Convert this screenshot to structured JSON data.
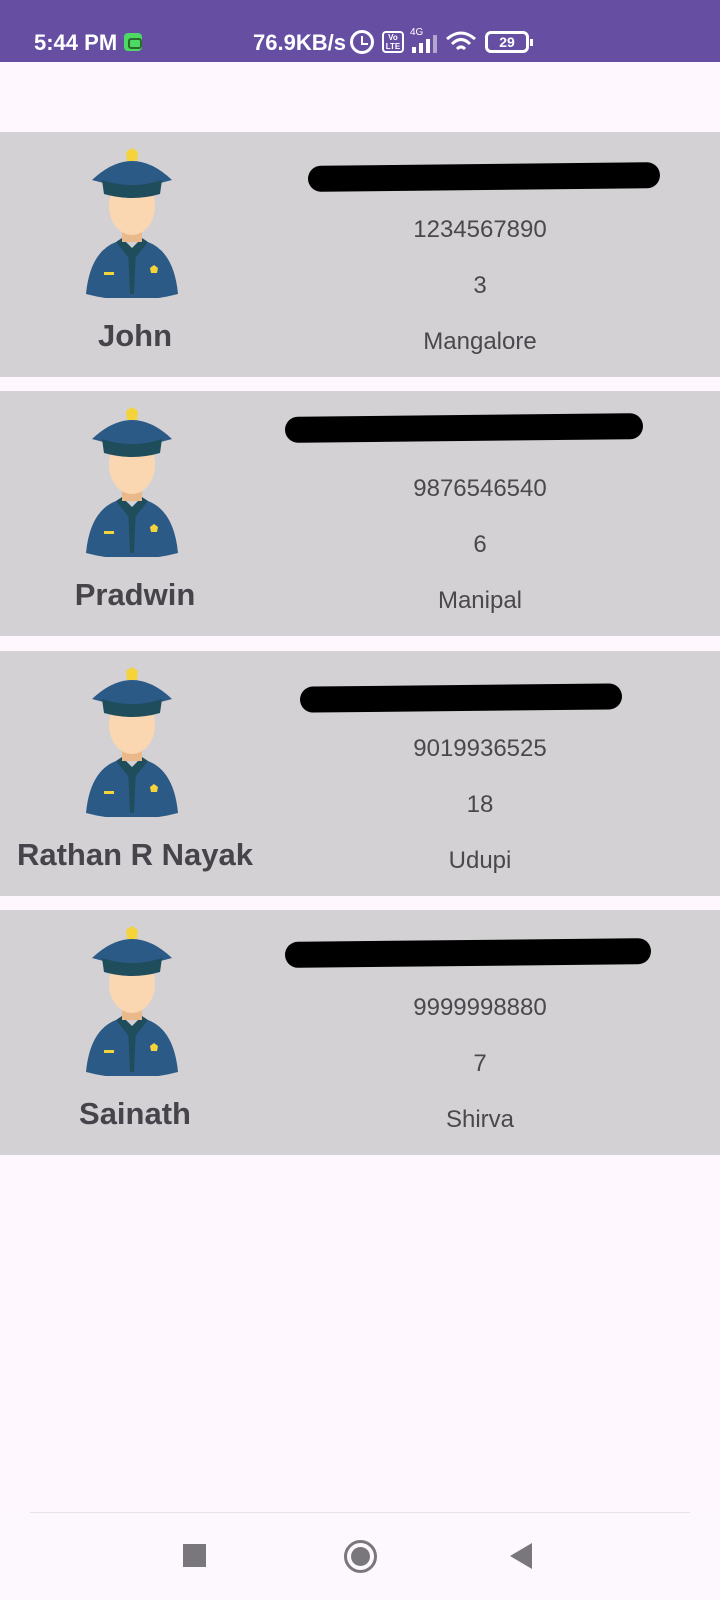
{
  "status_bar": {
    "time": "5:44 PM",
    "speed": "76.9KB/s",
    "network": "4G",
    "battery": "29",
    "volte_label": "Vo LTE",
    "icons": [
      "app-notification-icon",
      "alarm-icon",
      "volte-icon",
      "signal-icon",
      "wifi-icon",
      "battery-icon"
    ]
  },
  "officers": [
    {
      "name": "John",
      "phone": "1234567890",
      "count": "3",
      "city": "Mangalore"
    },
    {
      "name": "Pradwin",
      "phone": "9876546540",
      "count": "6",
      "city": "Manipal"
    },
    {
      "name": "Rathan R Nayak",
      "phone": "9019936525",
      "count": "18",
      "city": "Udupi"
    },
    {
      "name": "Sainath",
      "phone": "9999998880",
      "count": "7",
      "city": "Shirva"
    }
  ],
  "colors": {
    "status_bar": "#664fa3",
    "card_bg": "#d3d1d3",
    "page_bg": "#fef7fd",
    "uniform": "#2b5a87",
    "cap": "#1f4d5c",
    "skin": "#fad7b0",
    "badge": "#f5d33b"
  },
  "nav": {
    "icons": [
      "recents-square-icon",
      "home-circle-icon",
      "back-triangle-icon"
    ]
  }
}
